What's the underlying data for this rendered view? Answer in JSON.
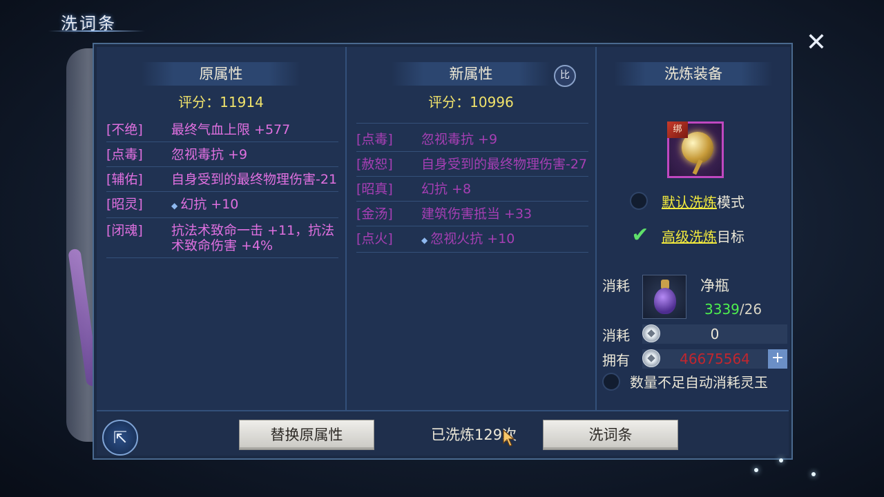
{
  "title": "洗词条",
  "close_icon": "close-icon",
  "left": {
    "header": "原属性",
    "score": "评分：11914",
    "attrs": [
      {
        "tag": "[不绝]",
        "value": "最终气血上限 +577"
      },
      {
        "tag": "[点毒]",
        "value": "忽视毒抗 +9"
      },
      {
        "tag": "[辅佑]",
        "value": "自身受到的最终物理伤害-21"
      },
      {
        "tag": "[昭灵]",
        "value": "幻抗 +10"
      },
      {
        "tag": "[闭魂]",
        "value": "抗法术致命一击 +11，抗法术致命伤害 +4%"
      }
    ]
  },
  "middle": {
    "header": "新属性",
    "compare_label": "比",
    "score": "评分：10996",
    "attrs": [
      {
        "tag": "[点毒]",
        "value": "忽视毒抗 +9"
      },
      {
        "tag": "[赦恕]",
        "value": "自身受到的最终物理伤害-27"
      },
      {
        "tag": "[昭真]",
        "value": "幻抗 +8"
      },
      {
        "tag": "[金汤]",
        "value": "建筑伤害抵当 +33"
      },
      {
        "tag": "[点火]",
        "value": "忽视火抗 +10"
      }
    ]
  },
  "right": {
    "header": "洗炼装备",
    "bind_label": "绑",
    "options": [
      {
        "link": "默认洗炼",
        "suffix": "模式",
        "checked": false
      },
      {
        "link": "高级洗炼",
        "suffix": "目标",
        "checked": true
      }
    ],
    "cost_label": "消耗",
    "item_name": "净瓶",
    "item_have": "3339",
    "item_need": "/26",
    "money_cost_label": "消耗",
    "money_cost": "0",
    "own_label": "拥有",
    "own_amount": "46675564",
    "plus": "+",
    "auto_label": "数量不足自动消耗灵玉"
  },
  "bottom": {
    "replace_button": "替换原属性",
    "refine_count": "已洗炼129次",
    "refine_button": "洗词条"
  },
  "colors": {
    "attr_original": "#e070e0",
    "attr_new": "#a63fb4",
    "score": "#f1e36b",
    "link": "#f3ea3d",
    "have_count": "#4ef04e",
    "own_amount": "#c2262e"
  }
}
